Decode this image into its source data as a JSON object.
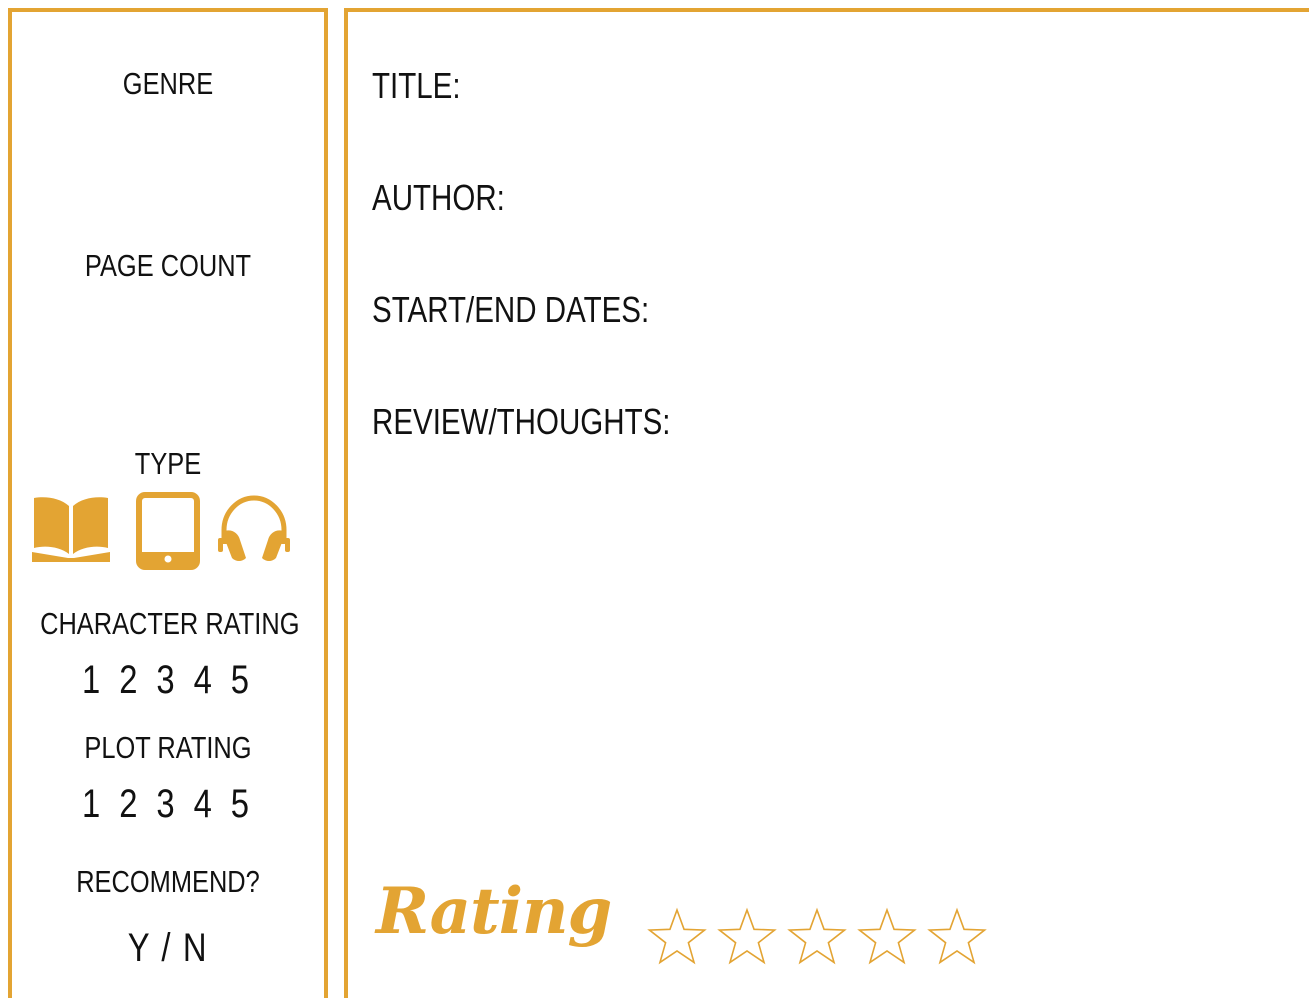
{
  "sidebar": {
    "genre_label": "GENRE",
    "page_count_label": "PAGE COUNT",
    "type_label": "TYPE",
    "type_icons": [
      "open-book-icon",
      "tablet-icon",
      "headphones-icon"
    ],
    "character_rating_label": "CHARACTER RATING",
    "character_rating_scale": "1 2 3 4 5",
    "plot_rating_label": "PLOT RATING",
    "plot_rating_scale": "1 2 3 4 5",
    "recommend_label": "RECOMMEND?",
    "recommend_options": "Y / N"
  },
  "main": {
    "title_label": "TITLE:",
    "author_label": "AUTHOR:",
    "dates_label": "START/END DATES:",
    "review_label": "REVIEW/THOUGHTS:"
  },
  "rating": {
    "label": "Rating",
    "stars_total": 5,
    "stars_filled": 0
  },
  "colors": {
    "accent": "#e3a433",
    "text": "#111111",
    "background": "#ffffff"
  }
}
